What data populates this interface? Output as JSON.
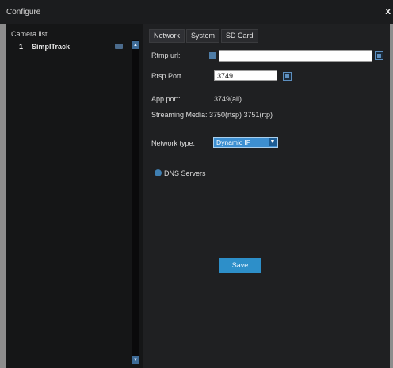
{
  "window": {
    "title": "Configure",
    "close_glyph": "x"
  },
  "camera_list": {
    "title": "Camera list",
    "items": [
      {
        "number": "1",
        "name": "SimplTrack"
      }
    ]
  },
  "tabs": [
    "Network",
    "System",
    "SD Card"
  ],
  "network": {
    "rtmp_url_label": "Rtmp url:",
    "rtmp_url_value": "",
    "rtsp_port_label": "Rtsp Port",
    "rtsp_port_value": "3749",
    "app_port_label": "App port:",
    "app_port_value": "3749(all)",
    "streaming_media_label": "Streaming Media:",
    "streaming_media_value": "3750(rtsp) 3751(rtp)",
    "network_type_label": "Network type:",
    "network_type_value": "Dynamic IP",
    "dns_label": "DNS Servers",
    "save_label": "Save"
  },
  "colors": {
    "accent": "#2d8fc9",
    "selected": "#3d8fd1",
    "background": "#1f2022"
  }
}
